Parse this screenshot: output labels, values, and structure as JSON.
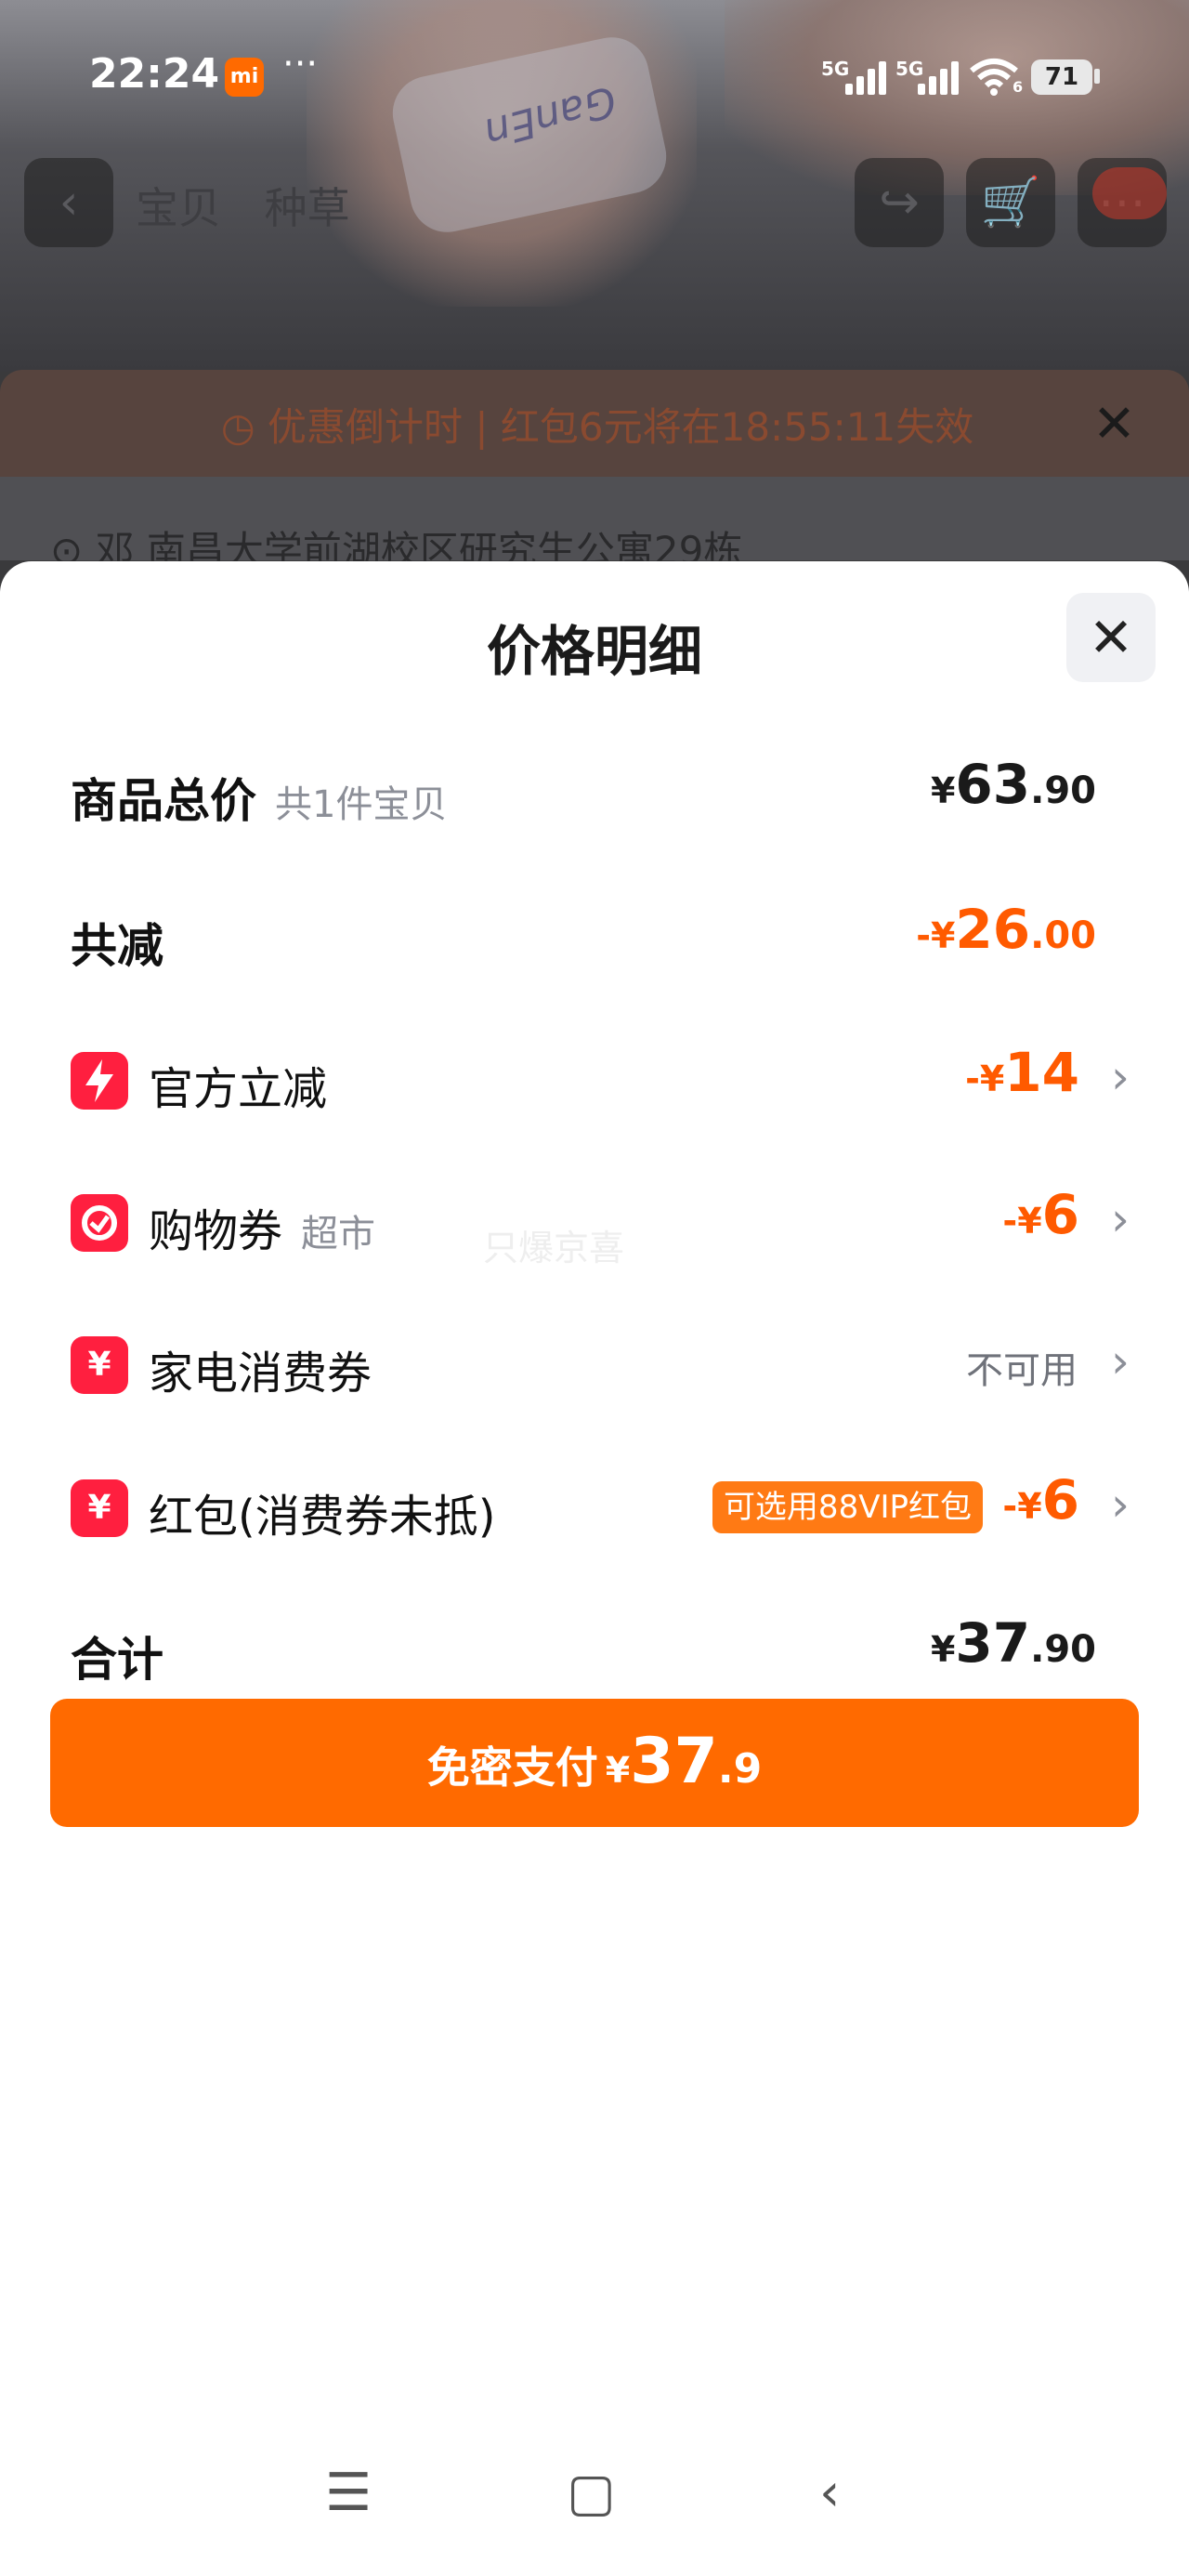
{
  "status_bar": {
    "time": "22:24",
    "mi_label": "mi",
    "dots": "···",
    "signal1": "5G",
    "signal2": "5G",
    "wifi_sub": "6",
    "battery": "71"
  },
  "background": {
    "bottle_text": "GanEn",
    "nav_tabs": [
      "宝贝",
      "种草"
    ],
    "countdown": {
      "label": "优惠倒计时",
      "message": "红包6元将在18:55:11失效"
    },
    "address": "邓 南昌大学前湖校区研究生公寓29栋"
  },
  "sheet": {
    "title": "价格明细",
    "rows": [
      {
        "label": "商品总价",
        "sub": "共1件宝贝",
        "yen": "¥",
        "big": "63",
        "small": ".90"
      },
      {
        "label": "共减",
        "yen": "-¥",
        "big": "26",
        "small": ".00"
      },
      {
        "label": "官方立减",
        "icon": "lightning-icon",
        "yen": "-¥",
        "big": "14"
      },
      {
        "label": "购物券",
        "sub": "超市",
        "icon": "coupon-icon",
        "yen": "-¥",
        "big": "6"
      },
      {
        "label": "家电消费券",
        "icon": "voucher-icon",
        "status": "不可用"
      },
      {
        "label": "红包(消费券未抵)",
        "icon": "red-packet-icon",
        "tag": "可选用88VIP红包",
        "yen": "-¥",
        "big": "6"
      },
      {
        "label": "合计",
        "yen": "¥",
        "big": "37",
        "small": ".90"
      }
    ],
    "watermark": "只爆京喜"
  },
  "pay_button": {
    "label": "免密支付",
    "yen": "¥",
    "big": "37",
    "small": ".9"
  },
  "colors": {
    "accent": "#ff6a00",
    "discount": "#ff5a00",
    "icon_red": "#ff1f3f"
  }
}
